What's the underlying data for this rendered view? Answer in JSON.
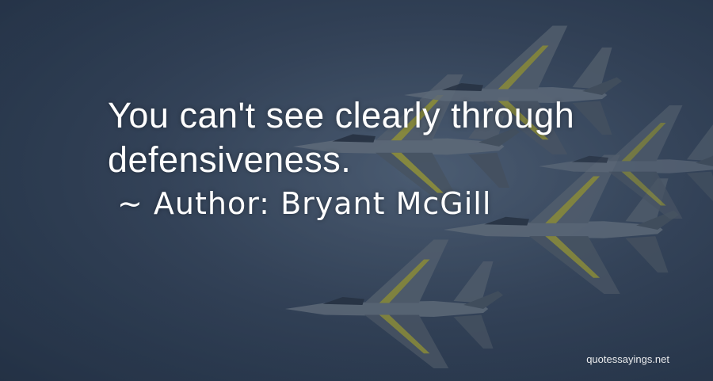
{
  "quote": {
    "lines": [
      "You can't see clearly through",
      "defensiveness."
    ],
    "author_prefix": "~ Author:",
    "author_name": "Bryant McGill"
  },
  "watermark": "quotessayings.net",
  "colors": {
    "text": "#ffffff",
    "sky": "#3f4f68",
    "jet_body": "#8a94a0",
    "jet_accent": "#c8c23a"
  },
  "background": {
    "icon": "fighter-jets-formation-icon"
  }
}
